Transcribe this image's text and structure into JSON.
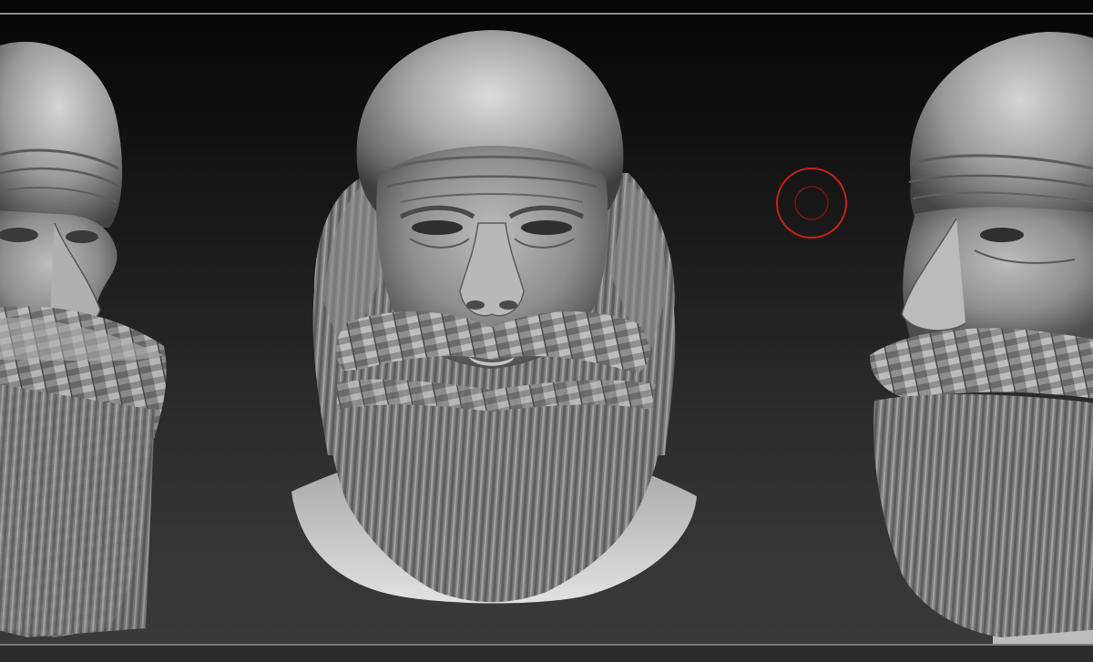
{
  "document": {
    "kind": "3D sculpt viewport render",
    "views": [
      {
        "name": "left-three-quarter"
      },
      {
        "name": "front"
      },
      {
        "name": "right-three-quarter"
      }
    ]
  },
  "colors": {
    "background_top": "#060606",
    "background_bottom": "#3a3a3a",
    "clay": "#9a9a9a",
    "clay_highlight": "#d9d9d9",
    "clay_shadow": "#3c3c3c",
    "beard_card_light": "#b5b5b5",
    "beard_card_dark": "#555555",
    "brush_cursor": "#cc1f1f",
    "frame_rule": "#8c8c8c"
  },
  "icons": {
    "brush_cursor": "draw-size-circle-icon"
  }
}
